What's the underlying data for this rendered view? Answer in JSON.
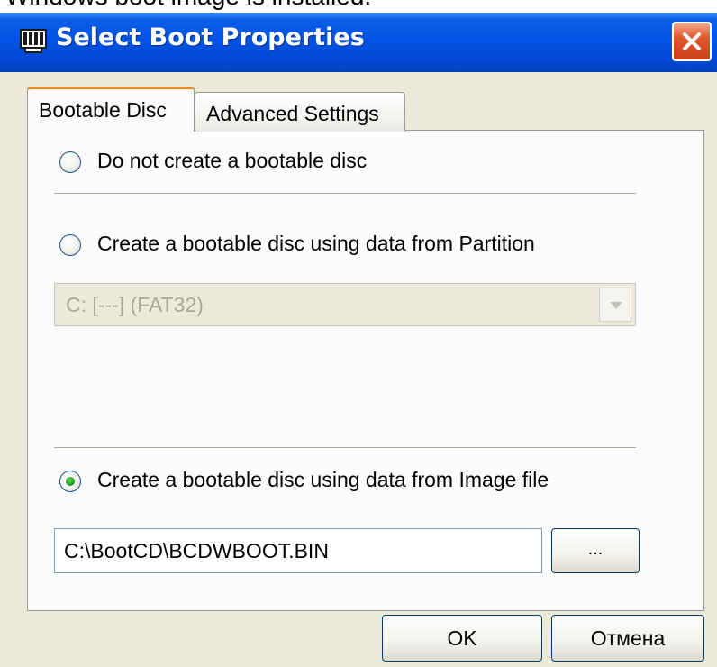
{
  "background_text": "Windows boot image is installed.",
  "window": {
    "title": "Select Boot Properties"
  },
  "tabs": [
    {
      "label": "Bootable Disc",
      "active": true
    },
    {
      "label": "Advanced Settings",
      "active": false
    }
  ],
  "options": {
    "no_boot": {
      "label": "Do not create a bootable disc",
      "checked": false
    },
    "partition": {
      "label": "Create a bootable disc using data from Partition",
      "checked": false
    },
    "image_file": {
      "label": "Create a bootable disc using data from Image file",
      "checked": true
    }
  },
  "partition_select": {
    "value": "C: [---] (FAT32)",
    "disabled": true
  },
  "image_path": {
    "value": "C:\\BootCD\\BCDWBOOT.BIN"
  },
  "buttons": {
    "browse": "...",
    "ok": "OK",
    "cancel": "Отмена"
  },
  "colors": {
    "titlebar": "#0054e3",
    "close": "#e2562c",
    "active_tab_accent": "#e68b2c",
    "window_bg": "#ece9d8",
    "panel_bg": "#fcfcfe"
  },
  "icons": {
    "window": "app-window-icon",
    "close": "close-icon",
    "dropdown": "chevron-down-icon"
  }
}
